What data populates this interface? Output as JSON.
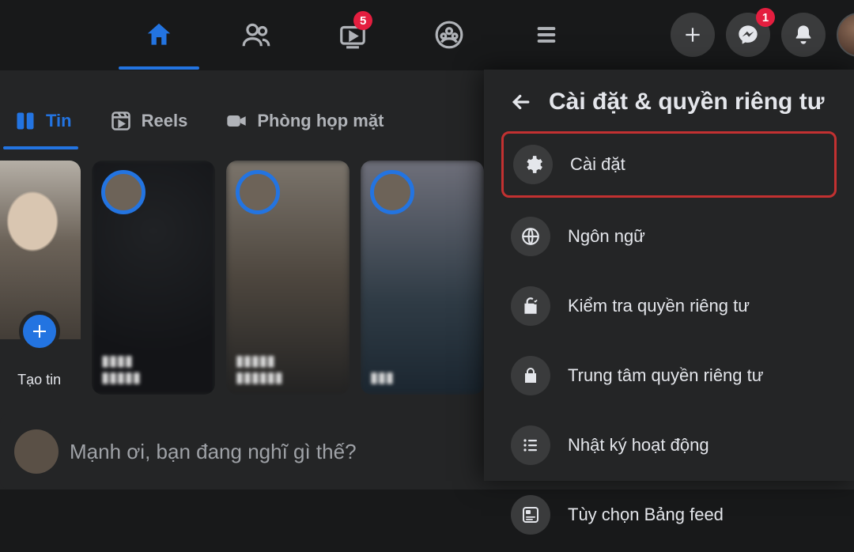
{
  "topnav": {
    "watch_badge": "5",
    "messenger_badge": "1"
  },
  "subtabs": {
    "feed": "Tin",
    "reels": "Reels",
    "rooms": "Phòng họp mặt"
  },
  "stories": {
    "create_label": "Tạo tin"
  },
  "composer": {
    "placeholder": "Mạnh ơi, bạn đang nghĩ gì thế?"
  },
  "panel": {
    "title": "Cài đặt & quyền riêng tư",
    "items": [
      {
        "label": "Cài đặt"
      },
      {
        "label": "Ngôn ngữ"
      },
      {
        "label": "Kiểm tra quyền riêng tư"
      },
      {
        "label": "Trung tâm quyền riêng tư"
      },
      {
        "label": "Nhật ký hoạt động"
      },
      {
        "label": "Tùy chọn Bảng feed"
      }
    ]
  }
}
